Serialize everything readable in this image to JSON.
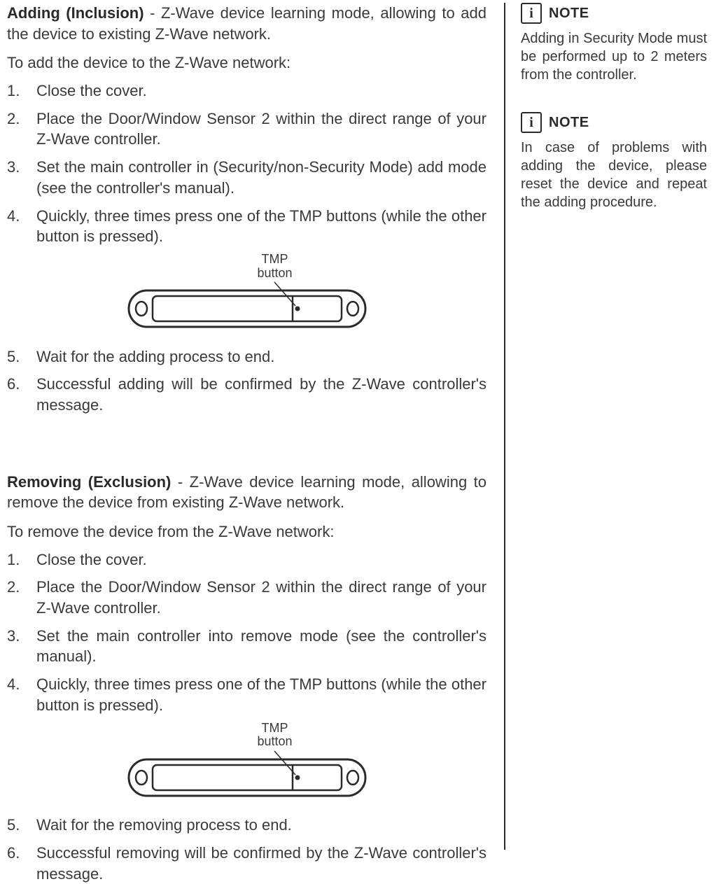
{
  "adding": {
    "title": "Adding (Inclusion)",
    "desc": " - Z-Wave device learning mode, allowing to add the device to existing Z-Wave network.",
    "lead": "To add the device to the Z-Wave network:",
    "steps": [
      "Close the cover.",
      "Place the Door/Window Sensor 2 within the direct range of your Z-Wave controller.",
      "Set the main controller in (Security/non-Security Mode) add mode (see the controller's manual).",
      "Quickly, three times press one of the TMP buttons (while the other button is pressed).",
      "Wait for the adding process to end.",
      "Successful adding will be confirmed by the Z-Wave controller's message."
    ]
  },
  "removing": {
    "title": "Removing (Exclusion)",
    "desc": " - Z-Wave device learning mode, allowing to remove the device from existing Z-Wave network.",
    "lead": "To remove the device from the Z-Wave network:",
    "steps": [
      "Close the cover.",
      "Place the Door/Window Sensor 2 within the direct range of your Z-Wave controller.",
      "Set the main controller into remove mode (see the controller's manual).",
      "Quickly, three times press one of the TMP buttons (while the other button is pressed).",
      "Wait for the removing process to end.",
      "Successful removing will be confirmed by the Z-Wave controller's message."
    ]
  },
  "diagram": {
    "label1": "TMP",
    "label2": "button"
  },
  "sidebar": {
    "note1": {
      "icon": "i",
      "title": "NOTE",
      "body": "Adding in Security Mode must be per­formed up to 2 meters from the controller."
    },
    "note2": {
      "icon": "i",
      "title": "NOTE",
      "body": "In case of problems with adding the de­vice, please reset the device and repeat the adding procedure."
    }
  }
}
